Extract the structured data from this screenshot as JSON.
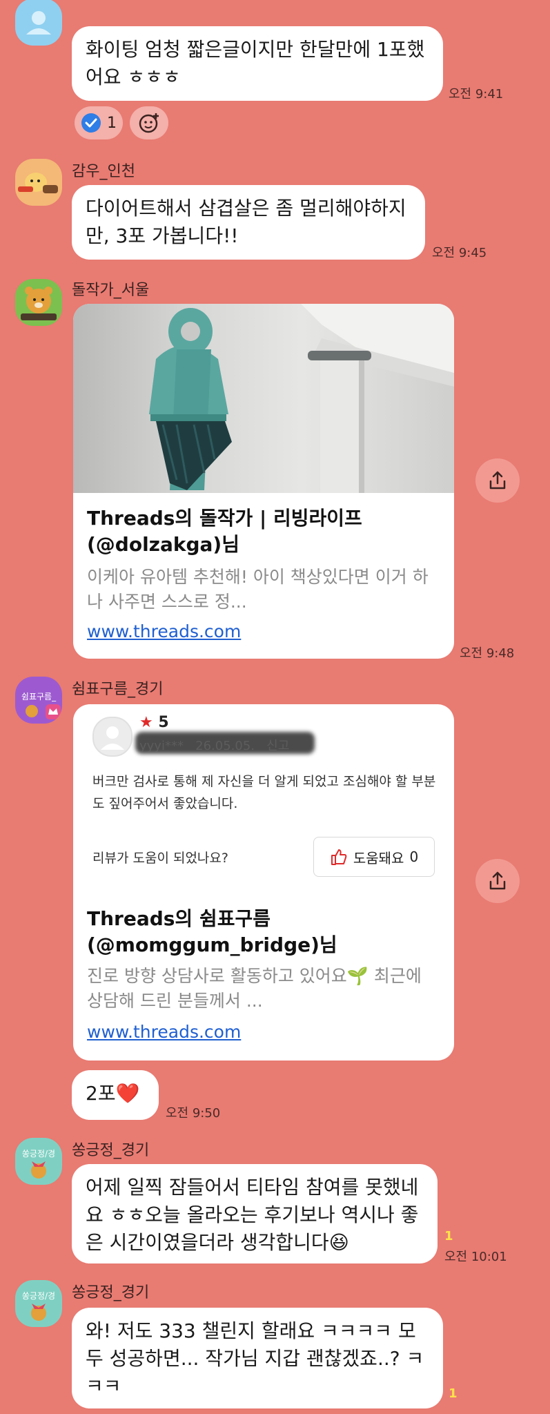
{
  "messages": {
    "m1": {
      "text": "화이팅 엄청 짧은글이지만 한달만에 1포했어요 ㅎㅎㅎ",
      "time": "오전 9:41",
      "reaction_count": "1"
    },
    "m2": {
      "sender": "감우_인천",
      "text": "다이어트해서 삼겹살은 좀 멀리해야하지만, 3포 가봅니다!!",
      "time": "오전 9:45"
    },
    "m3": {
      "sender": "돌작가_서울",
      "card_title": "Threads의 돌작가 | 리빙라이프 (@dolzakga)님",
      "card_desc": "이케아 유아템 추천해! 아이 책상있다면 이거 하나 사주면 스스로 정...",
      "card_link": "www.threads.com",
      "time": "오전 9:48"
    },
    "m4": {
      "sender": "쉼표구름_경기",
      "avatar_text": "쉼표구름_",
      "review_rating": "5",
      "review_meta": "yyyi***   26.05.05.   신고",
      "review_text": "버크만 검사로 통해 제 자신을 더 알게 되었고 조심해야 할 부분도 짚어주어서 좋았습니다.",
      "review_question": "리뷰가 도움이 되었나요?",
      "helpful_label": "도움돼요",
      "helpful_count": "0",
      "card_title": "Threads의 쉼표구름 (@momggum_bridge)님",
      "card_desc": "진로 방향 상담사로 활동하고 있어요🌱 최근에 상담해 드린 분들께서 ...",
      "card_link": "www.threads.com"
    },
    "m5": {
      "text": "2포❤️",
      "time": "오전 9:50"
    },
    "m6": {
      "sender": "쏭긍정_경기",
      "avatar_text": "쏭긍정/경",
      "text": "어제 일찍 잠들어서 티타임 참여를 못했네요 ㅎㅎ오늘 올라오는 후기보나 역시나 좋은 시간이였을더라 생각합니다😆",
      "unread": "1",
      "time": "오전 10:01"
    },
    "m7": {
      "sender": "쏭긍정_경기",
      "avatar_text": "쏭긍정/경",
      "text": "와! 저도 333 챌린지 할래요 ㅋㅋㅋㅋ 모두 성공하면... 작가님 지갑 괜찮겠죠..? ㅋㅋㅋ",
      "unread": "1"
    }
  },
  "colors": {
    "background": "#e87b72",
    "bubble": "#ffffff",
    "link": "#1f5fd1",
    "unread": "#ffe24a"
  }
}
